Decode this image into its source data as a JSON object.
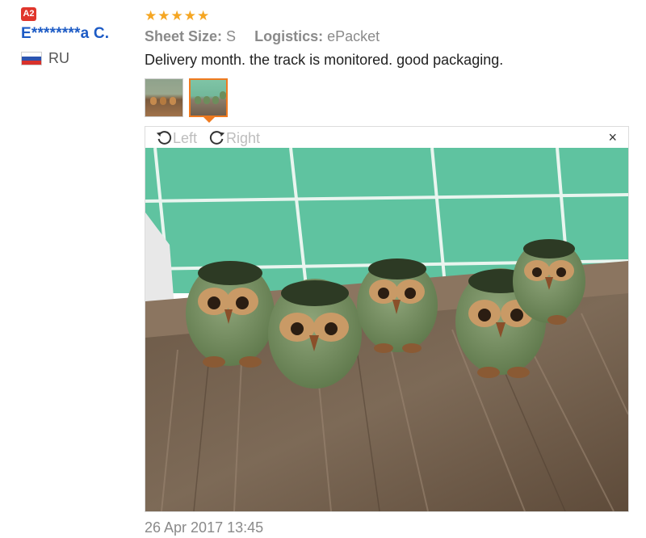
{
  "reviewer": {
    "badge": "A2",
    "name": "E********a C.",
    "country": "RU"
  },
  "rating": {
    "stars": 5,
    "max": 5
  },
  "order_info": {
    "sheet_size_label": "Sheet Size:",
    "sheet_size_value": "S",
    "logistics_label": "Logistics:",
    "logistics_value": "ePacket"
  },
  "review": {
    "text": "Delivery month. the track is monitored. good packaging.",
    "date": "26 Apr 2017 13:45"
  },
  "viewer": {
    "rotate_left_label": "Left",
    "rotate_right_label": "Right",
    "close_label": "×",
    "selected_thumbnail": 2
  },
  "icons": {
    "rotate_left": "rotate-left-icon",
    "rotate_right": "rotate-right-icon",
    "close": "close-icon",
    "star": "star-icon"
  },
  "colors": {
    "username": "#1d5bc5",
    "star": "#f5a623",
    "badge": "#e0362c",
    "selected_border": "#ef7a1f"
  }
}
